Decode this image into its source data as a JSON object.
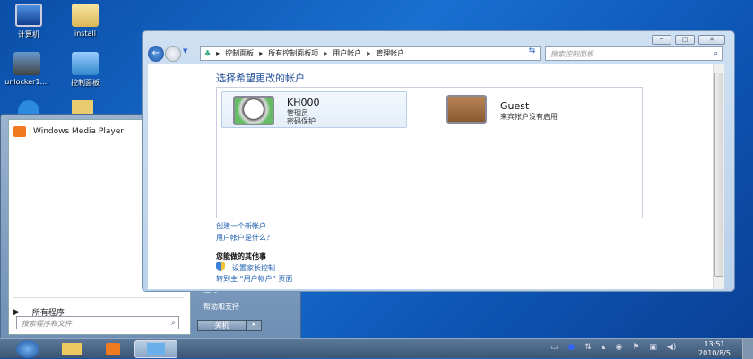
{
  "desktop": {
    "icons": [
      {
        "label": "计算机"
      },
      {
        "label": "install"
      },
      {
        "label": "unlocker1...."
      },
      {
        "label": "控制面板"
      }
    ]
  },
  "start_menu": {
    "pinned": [
      {
        "label": "Windows Media Player"
      }
    ],
    "all_programs": "所有程序",
    "search_placeholder": "搜索程序和文件",
    "right_items": [
      {
        "label": "运行..."
      },
      {
        "label": "帮助和支持"
      }
    ],
    "shutdown": "关机"
  },
  "window": {
    "breadcrumb": [
      "控制面板",
      "所有控制面板项",
      "用户帐户",
      "管理帐户"
    ],
    "search_placeholder": "搜索控制面板",
    "heading": "选择希望更改的帐户",
    "accounts": [
      {
        "name": "KH000",
        "line1": "管理员",
        "line2": "密码保护"
      },
      {
        "name": "Guest",
        "line1": "来宾帐户没有启用"
      }
    ],
    "links": [
      "创建一个新帐户",
      "用户帐户是什么？"
    ],
    "other_heading": "您能做的其他事",
    "other_links": [
      "设置家长控制",
      "转到主 “用户帐户” 页面"
    ]
  },
  "taskbar": {
    "time": "13:51",
    "date": "2010/8/5"
  }
}
